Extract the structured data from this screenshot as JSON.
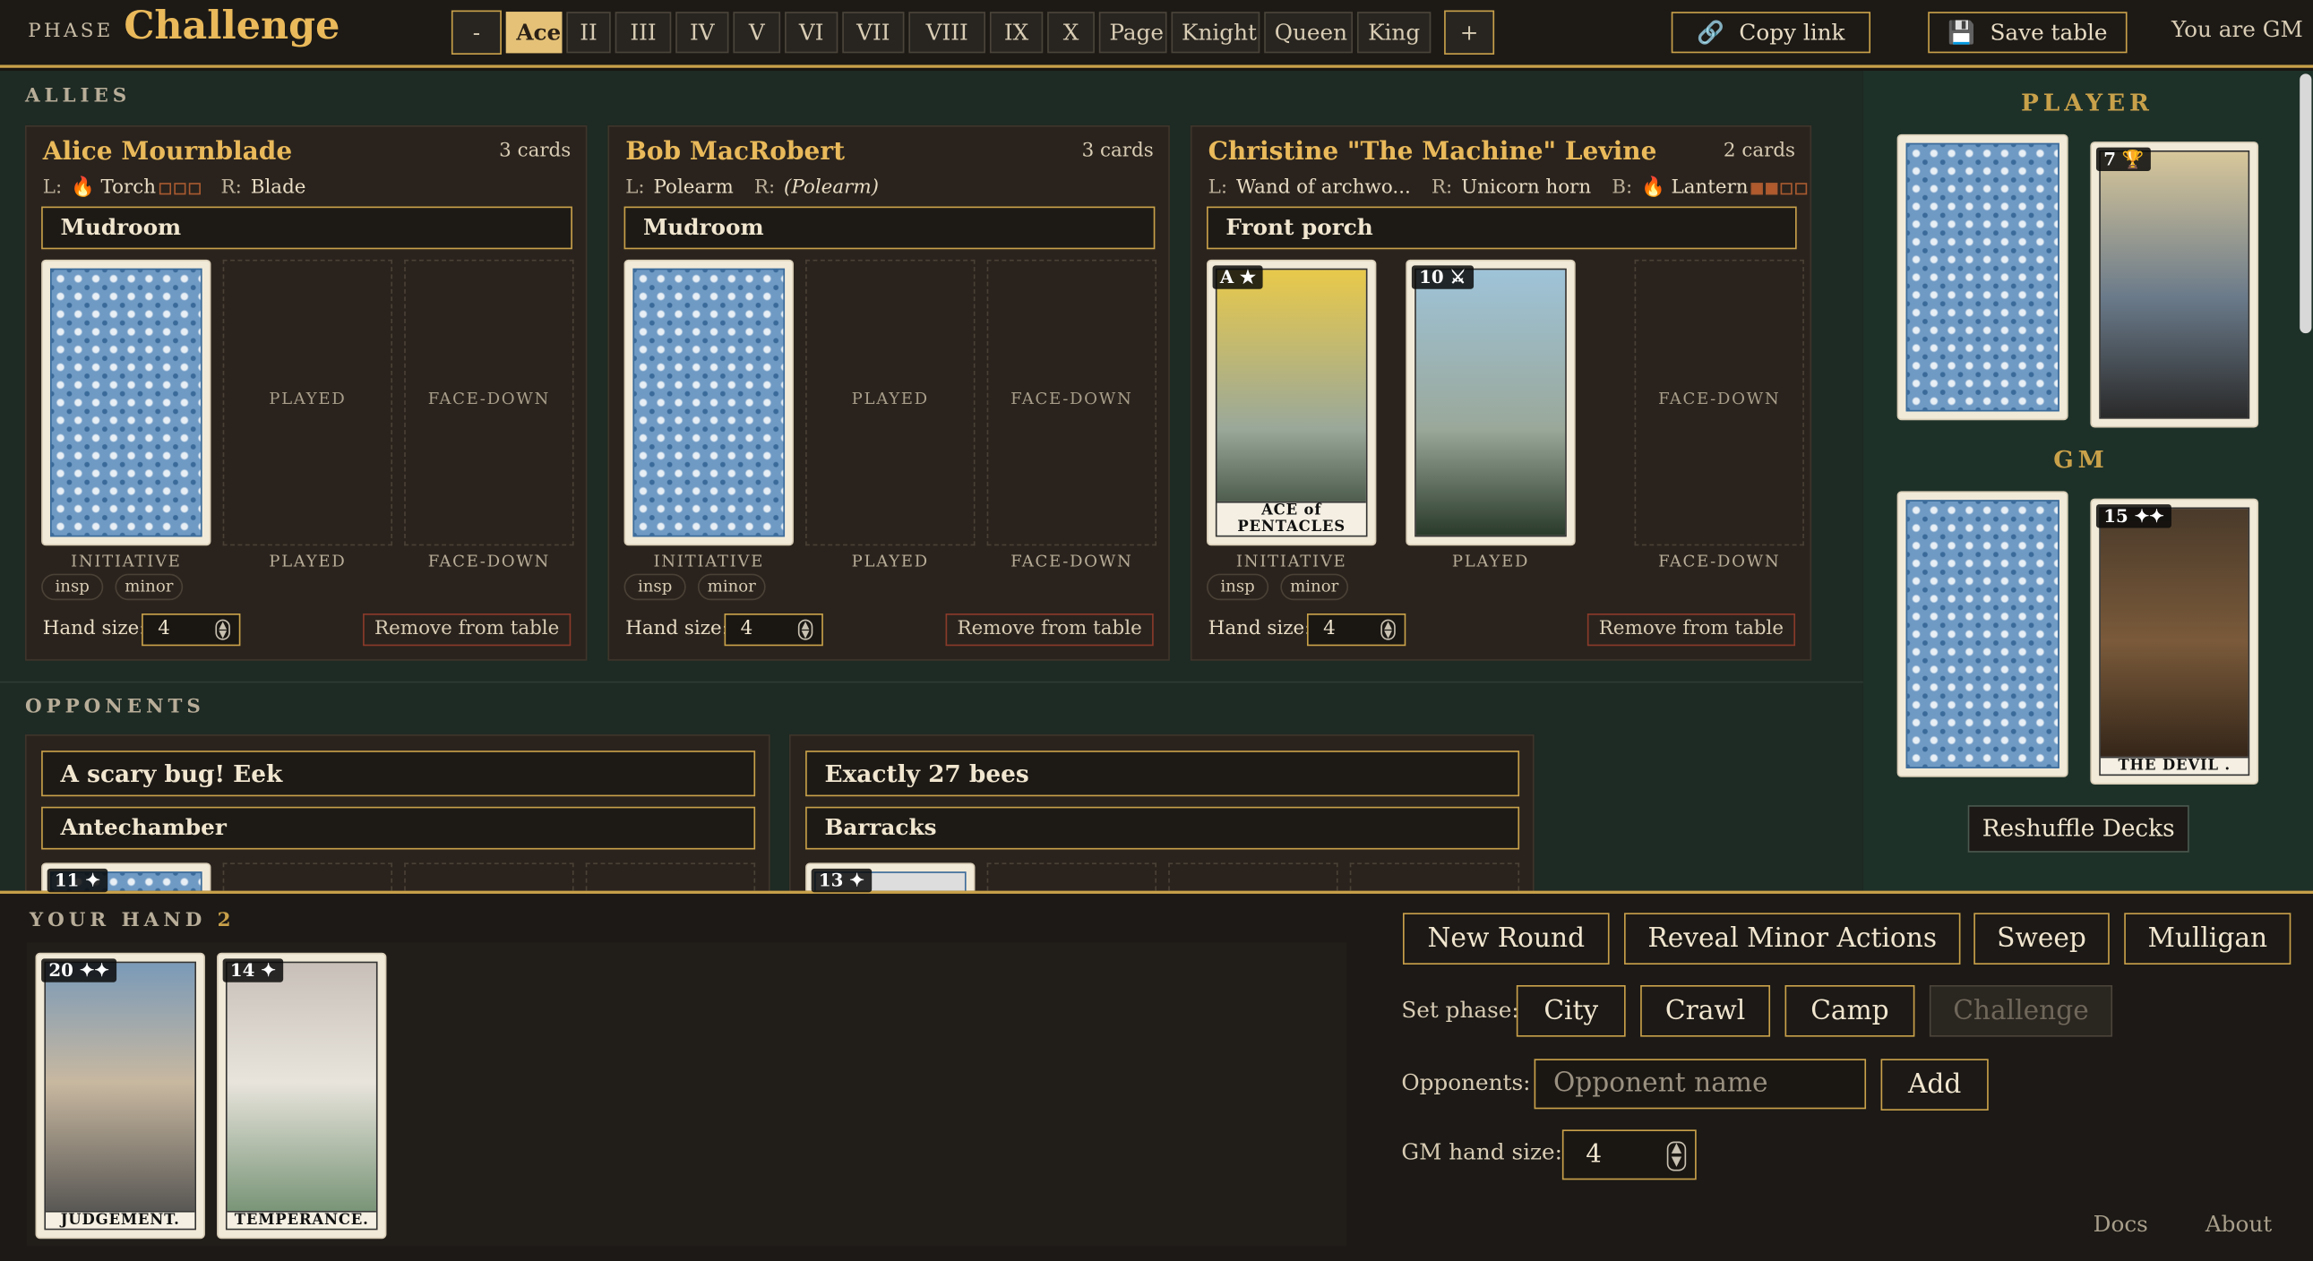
{
  "topbar": {
    "phase_label": "PHASE",
    "phase_value": "Challenge",
    "minus": "-",
    "plus": "+",
    "ranks": [
      "Ace",
      "II",
      "III",
      "IV",
      "V",
      "VI",
      "VII",
      "VIII",
      "IX",
      "X",
      "Page",
      "Knight",
      "Queen",
      "King"
    ],
    "selected_rank": "Ace",
    "copy_link": "Copy link",
    "save_table": "Save table",
    "whoami": "You are GM"
  },
  "allies": {
    "label": "ALLIES",
    "players": [
      {
        "name": "Alice Mournblade",
        "count": "3 cards",
        "equip": [
          {
            "k": "L:",
            "v": "Torch",
            "flame": true,
            "pips": [
              0,
              0,
              0
            ]
          },
          {
            "k": "R:",
            "v": "Blade"
          }
        ],
        "location": "Mudroom",
        "slots": [
          {
            "caption": "INITIATIVE",
            "card": "back"
          },
          {
            "caption": "PLAYED",
            "empty": "PLAYED"
          },
          {
            "caption": "FACE-DOWN",
            "empty": "FACE-DOWN"
          }
        ],
        "tags": [
          "insp",
          "minor"
        ],
        "hand_label": "Hand size:",
        "hand_size": "4",
        "remove": "Remove from table"
      },
      {
        "name": "Bob MacRobert",
        "count": "3 cards",
        "equip": [
          {
            "k": "L:",
            "v": "Polearm"
          },
          {
            "k": "R:",
            "v": "(Polearm)",
            "italic": true
          }
        ],
        "location": "Mudroom",
        "slots": [
          {
            "caption": "INITIATIVE",
            "card": "back"
          },
          {
            "caption": "PLAYED",
            "empty": "PLAYED"
          },
          {
            "caption": "FACE-DOWN",
            "empty": "FACE-DOWN"
          }
        ],
        "tags": [
          "insp",
          "minor"
        ],
        "hand_label": "Hand size:",
        "hand_size": "4",
        "remove": "Remove from table"
      },
      {
        "name": "Christine \"The Machine\" Levine",
        "count": "2 cards",
        "equip": [
          {
            "k": "L:",
            "v": "Wand of archwo..."
          },
          {
            "k": "R:",
            "v": "Unicorn horn"
          },
          {
            "k": "B:",
            "v": "Lantern",
            "flame": true,
            "pips": [
              1,
              1,
              0,
              0
            ]
          }
        ],
        "location": "Front porch",
        "slots": [
          {
            "caption": "INITIATIVE",
            "card": "face",
            "badge": "A ★",
            "label": "ACE of PENTACLES",
            "color": "#e8c94a"
          },
          {
            "caption": "PLAYED",
            "card": "face",
            "badge": "10 ⚔",
            "label": "",
            "color": "#9ec3d8"
          },
          {
            "caption": "FACE-DOWN",
            "empty": "FACE-DOWN"
          }
        ],
        "tags": [
          "insp",
          "minor"
        ],
        "hand_label": "Hand size:",
        "hand_size": "4",
        "remove": "Remove from table"
      }
    ]
  },
  "opponents": {
    "label": "OPPONENTS",
    "items": [
      {
        "name": "A scary bug! Eek",
        "location": "Antechamber",
        "badge": "11 ✦"
      },
      {
        "name": "Exactly 27 bees",
        "location": "Barracks",
        "badge": "13 ✦"
      }
    ]
  },
  "sidebar": {
    "player_label": "PLAYER",
    "gm_label": "GM",
    "player_badge": "7 🏆",
    "gm_badge": "15 ✦✦",
    "gm_card_label": "THE DEVIL .",
    "reshuffle": "Reshuffle Decks"
  },
  "hand": {
    "label": "YOUR HAND",
    "count": "2",
    "cards": [
      {
        "badge": "20 ✦✦",
        "label": "JUDGEMENT."
      },
      {
        "badge": "14 ✦",
        "label": "TEMPERANCE."
      }
    ]
  },
  "controls": {
    "new_round": "New Round",
    "reveal": "Reveal Minor Actions",
    "sweep": "Sweep",
    "mulligan": "Mulligan",
    "set_phase_label": "Set phase:",
    "phases": [
      "City",
      "Crawl",
      "Camp",
      "Challenge"
    ],
    "opponents_label": "Opponents:",
    "opponent_placeholder": "Opponent name",
    "add": "Add",
    "gm_hand_label": "GM hand size:",
    "gm_hand_size": "4"
  },
  "footer": {
    "docs": "Docs",
    "about": "About"
  }
}
